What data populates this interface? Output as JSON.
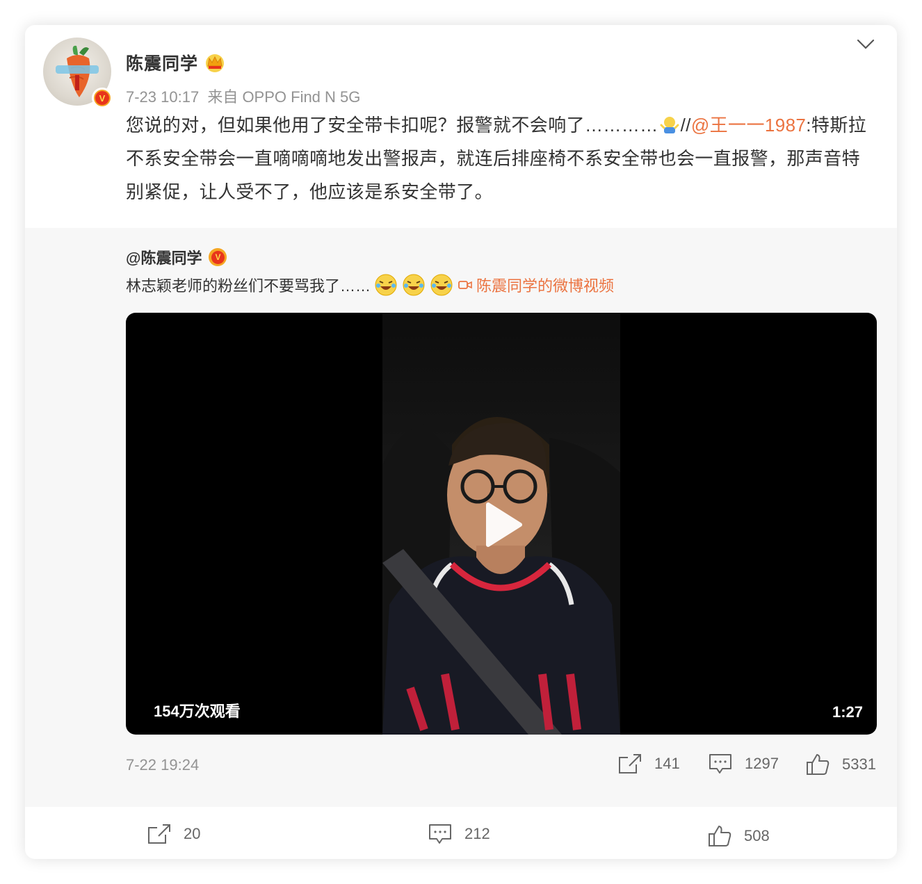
{
  "post": {
    "author": "陈震同学",
    "time": "7-23 10:17",
    "source": "来自 OPPO Find N 5G",
    "text_before": "您说的对，但如果他用了安全带卡扣呢？报警就不会响了…………",
    "text_sep": "//",
    "mention": "@王一一1987",
    "text_after": ":特斯拉不系安全带会一直嘀嘀嘀地发出警报声，就连后排座椅不系安全带也会一直报警，那声音特别紧促，让人受不了，他应该是系安全带了。",
    "icons": {
      "more": "chevron-down-icon",
      "crown": "crown-icon",
      "verified": "verified-badge-icon",
      "emoji": "shrug-emoji-icon"
    }
  },
  "repost": {
    "author": "@陈震同学",
    "text": "林志颖老师的粉丝们不要骂我了……",
    "video_link": "陈震同学的微博视频",
    "video": {
      "views": "154万次观看",
      "duration": "1:27"
    },
    "time": "7-22 19:24",
    "shares": "141",
    "comments": "1297",
    "likes": "5331"
  },
  "footer": {
    "shares": "20",
    "comments": "212",
    "likes": "508"
  },
  "colors": {
    "mention": "#eb7340",
    "meta": "#939393",
    "repost_bg": "#f7f7f7"
  }
}
